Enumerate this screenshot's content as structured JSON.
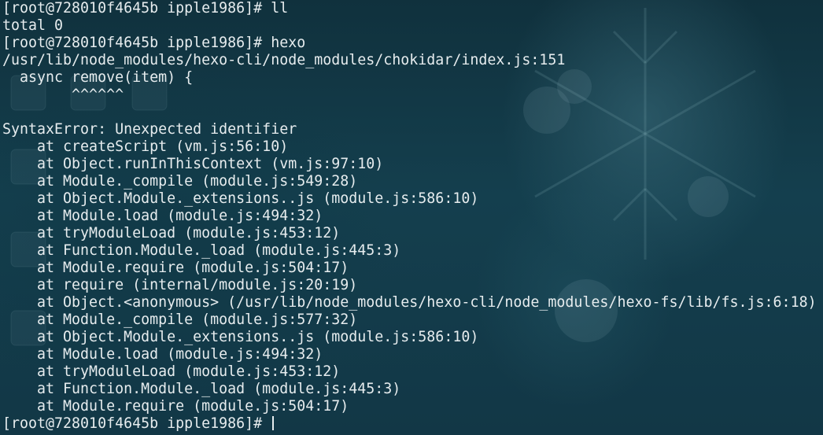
{
  "terminal": {
    "lines": [
      "[root@728010f4645b ipple1986]# ll",
      "total 0",
      "[root@728010f4645b ipple1986]# hexo",
      "/usr/lib/node_modules/hexo-cli/node_modules/chokidar/index.js:151",
      "  async remove(item) {",
      "        ^^^^^^",
      "",
      "SyntaxError: Unexpected identifier",
      "    at createScript (vm.js:56:10)",
      "    at Object.runInThisContext (vm.js:97:10)",
      "    at Module._compile (module.js:549:28)",
      "    at Object.Module._extensions..js (module.js:586:10)",
      "    at Module.load (module.js:494:32)",
      "    at tryModuleLoad (module.js:453:12)",
      "    at Function.Module._load (module.js:445:3)",
      "    at Module.require (module.js:504:17)",
      "    at require (internal/module.js:20:19)",
      "    at Object.<anonymous> (/usr/lib/node_modules/hexo-cli/node_modules/hexo-fs/lib/fs.js:6:18)",
      "    at Module._compile (module.js:577:32)",
      "    at Object.Module._extensions..js (module.js:586:10)",
      "    at Module.load (module.js:494:32)",
      "    at tryModuleLoad (module.js:453:12)",
      "    at Function.Module._load (module.js:445:3)",
      "    at Module.require (module.js:504:17)"
    ],
    "prompt": "[root@728010f4645b ipple1986]# ",
    "colors": {
      "background": "#123a48",
      "foreground": "#e6ecee"
    }
  }
}
